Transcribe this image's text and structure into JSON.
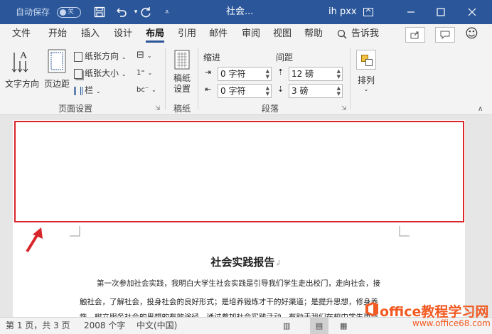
{
  "titlebar": {
    "autosave_label": "自动保存",
    "autosave_state": "关",
    "doc_title": "社会...",
    "user_name": "ih pxx"
  },
  "tabs": [
    "文件",
    "开始",
    "插入",
    "设计",
    "布局",
    "引用",
    "邮件",
    "审阅",
    "视图",
    "帮助"
  ],
  "active_tab": "布局",
  "tell_me": "告诉我",
  "ribbon": {
    "text_direction": "文字方向",
    "margins": "页边距",
    "orientation": "纸张方向",
    "size": "纸张大小",
    "columns": "栏",
    "page_setup_group": "页面设置",
    "manuscript_btn": "稿纸设置",
    "manuscript_group": "稿纸",
    "indent_label": "缩进",
    "spacing_label": "间距",
    "indent_left": "0 字符",
    "indent_right": "0 字符",
    "spacing_before": "12 磅",
    "spacing_after": "3 磅",
    "paragraph_group": "段落",
    "arrange": "排列"
  },
  "document": {
    "heading": "社会实践报告",
    "paragraph_mark": "↲",
    "lines": [
      "第一次参加社会实践，我明白大学生社会实践是引导我们学生走出校门，走向社会，接",
      "触社会，了解社会，投身社会的良好形式；是培养锻炼才干的好渠道；是提升思想，修身养",
      "性，树立服务社会的思想的有效途径。通过参加社会实践活动，有助于我们在校中学生更新"
    ]
  },
  "statusbar": {
    "page_info": "第 1 页，共 3 页",
    "word_count": "2008 个字",
    "language": "中文(中国)"
  },
  "watermark": {
    "text": "office教程学习网",
    "url": "www.office68.com"
  },
  "colors": {
    "titlebar": "#2b579a",
    "highlight_box": "#d9262c",
    "arrow": "#d9262c",
    "watermark": "#f15a22"
  }
}
